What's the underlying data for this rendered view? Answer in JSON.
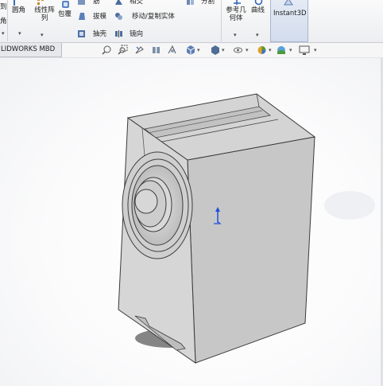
{
  "ribbon": {
    "items": {
      "a_label": "到",
      "b_label": "角",
      "round": "圆角",
      "linear_pattern": "线性阵\n列",
      "wrap": "包覆",
      "rib": "筋",
      "draft": "拔模",
      "shell": "抽壳",
      "intersect": "相交",
      "move_copy": "移动/复制实体",
      "mirror": "镜向",
      "split": "分割",
      "ref_geometry": "参考几\n何体",
      "curves": "曲线",
      "instant3d": "Instant3D"
    }
  },
  "tabs": [
    {
      "label": "LIDWORKS MBD"
    }
  ],
  "hud_icons": [
    "zoom-to-fit",
    "zoom-area",
    "previous-view",
    "section-view",
    "dynamic-annotation",
    "view-orientation",
    "display-style",
    "hide-show",
    "edit-appearance",
    "apply-scene",
    "view-settings"
  ],
  "colors": {
    "ribbon_bg": "#eceef1",
    "viewport_bg": "#f8f8f9",
    "part_face": "#c9c9c9",
    "triad_blue": "#1f4fe0"
  }
}
